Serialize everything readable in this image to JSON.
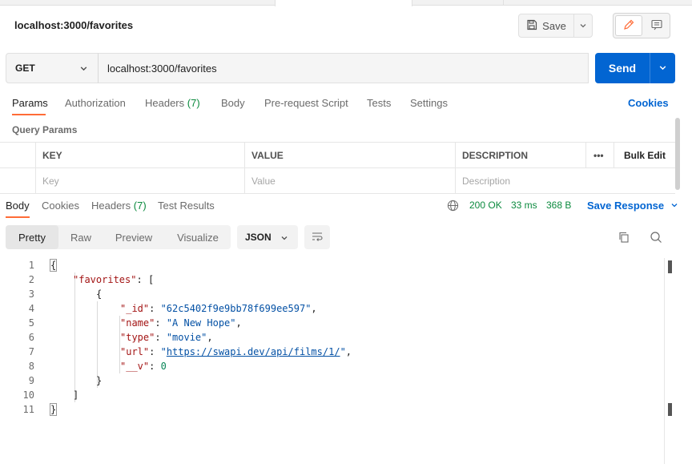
{
  "window": {
    "title": "localhost:3000/favorites"
  },
  "toolbar": {
    "save_label": "Save"
  },
  "request": {
    "method": "GET",
    "url": "localhost:3000/favorites",
    "send_label": "Send"
  },
  "request_tabs": [
    {
      "label": "Params"
    },
    {
      "label": "Authorization"
    },
    {
      "label": "Headers",
      "count": "(7)"
    },
    {
      "label": "Body"
    },
    {
      "label": "Pre-request Script"
    },
    {
      "label": "Tests"
    },
    {
      "label": "Settings"
    }
  ],
  "cookies_label": "Cookies",
  "query_params": {
    "title": "Query Params",
    "columns": {
      "key": "KEY",
      "value": "VALUE",
      "description": "DESCRIPTION",
      "more": "•••",
      "bulk_edit": "Bulk Edit"
    },
    "placeholders": {
      "key": "Key",
      "value": "Value",
      "description": "Description"
    }
  },
  "response_tabs": [
    {
      "label": "Body"
    },
    {
      "label": "Cookies"
    },
    {
      "label": "Headers",
      "count": "(7)"
    },
    {
      "label": "Test Results"
    }
  ],
  "response_status": {
    "code": "200 OK",
    "time": "33 ms",
    "size": "368 B",
    "save_response": "Save Response"
  },
  "view_modes": [
    "Pretty",
    "Raw",
    "Preview",
    "Visualize"
  ],
  "format": "JSON",
  "code": {
    "line_numbers": [
      "1",
      "2",
      "3",
      "4",
      "5",
      "6",
      "7",
      "8",
      "9",
      "10",
      "11"
    ],
    "open_brace": "{",
    "favorites_key": "\"favorites\"",
    "open_bracket": "[",
    "item_open": "{",
    "id_key": "\"_id\"",
    "id_val": "\"62c5402f9e9bb78f699ee597\"",
    "name_key": "\"name\"",
    "name_val": "\"A New Hope\"",
    "type_key": "\"type\"",
    "type_val": "\"movie\"",
    "url_key": "\"url\"",
    "url_val": "https://swapi.dev/api/films/1/",
    "v_key": "\"__v\"",
    "v_val": "0",
    "item_close": "}",
    "close_bracket": "]",
    "close_brace": "}"
  },
  "colors": {
    "accent": "#0265d2",
    "tab_indicator": "#ff6c37",
    "status_ok": "#0b8a3e"
  }
}
